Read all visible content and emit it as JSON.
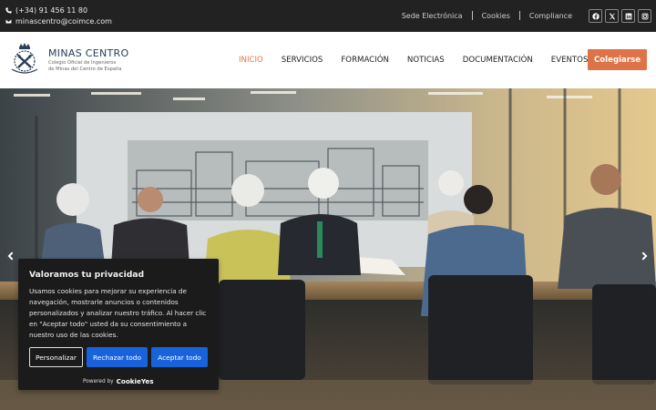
{
  "topbar": {
    "phone": "(+34) 91 456 11 80",
    "email": "minascentro@coimce.com",
    "links": [
      "Sede Electrónica",
      "Cookies",
      "Compliance"
    ],
    "social_icons": [
      "facebook-icon",
      "x-icon",
      "linkedin-icon",
      "instagram-icon"
    ]
  },
  "header": {
    "logo_title": "MINAS CENTRO",
    "logo_subtitle_line1": "Colegio Oficial de Ingenieros",
    "logo_subtitle_line2": "de Minas del Centro de España",
    "nav": [
      {
        "label": "INICIO",
        "active": true
      },
      {
        "label": "SERVICIOS"
      },
      {
        "label": "FORMACIÓN"
      },
      {
        "label": "NOTICIAS"
      },
      {
        "label": "DOCUMENTACIÓN"
      },
      {
        "label": "EVENTOS",
        "dropdown": true
      }
    ],
    "cta_label": "Colegiarse"
  },
  "cookie_banner": {
    "title": "Valoramos tu privacidad",
    "body": "Usamos cookies para mejorar su experiencia de navegación, mostrarle anuncios o contenidos personalizados y analizar nuestro tráfico. Al hacer clic en \"Aceptar todo\" usted da su consentimiento a nuestro uso de las cookies.",
    "btn_customize": "Personalizar",
    "btn_reject": "Rechazar todo",
    "btn_accept": "Aceptar todo",
    "powered_by": "Powered by",
    "powered_brand": "CookieYes"
  },
  "colors": {
    "topbar_bg": "#222222",
    "accent": "#dd7346",
    "cookie_bg": "#1b1b1b",
    "cookie_button_blue": "#1863dc"
  }
}
